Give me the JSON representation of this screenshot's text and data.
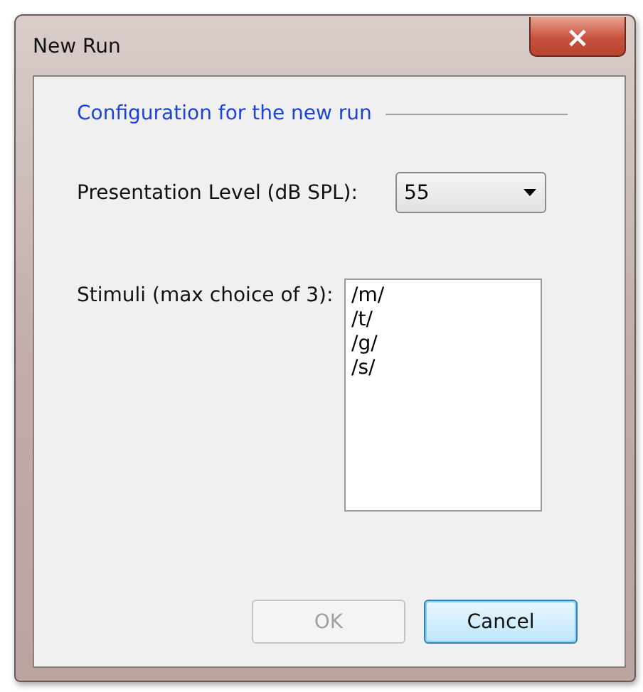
{
  "window": {
    "title": "New Run",
    "close": "×"
  },
  "group": {
    "title": "Configuration for the new run"
  },
  "level_field": {
    "label": "Presentation Level (dB SPL):",
    "value": "55"
  },
  "stimuli": {
    "label": "Stimuli (max choice of 3):",
    "items": [
      {
        "text": "/m/",
        "selected": false
      },
      {
        "text": "/t/",
        "selected": false
      },
      {
        "text": "/g/",
        "selected": false
      },
      {
        "text": "/s/",
        "selected": false
      }
    ]
  },
  "buttons": [
    {
      "label": "OK",
      "disabled": true,
      "focused": false
    },
    {
      "label": "Cancel",
      "disabled": false,
      "focused": true
    }
  ]
}
